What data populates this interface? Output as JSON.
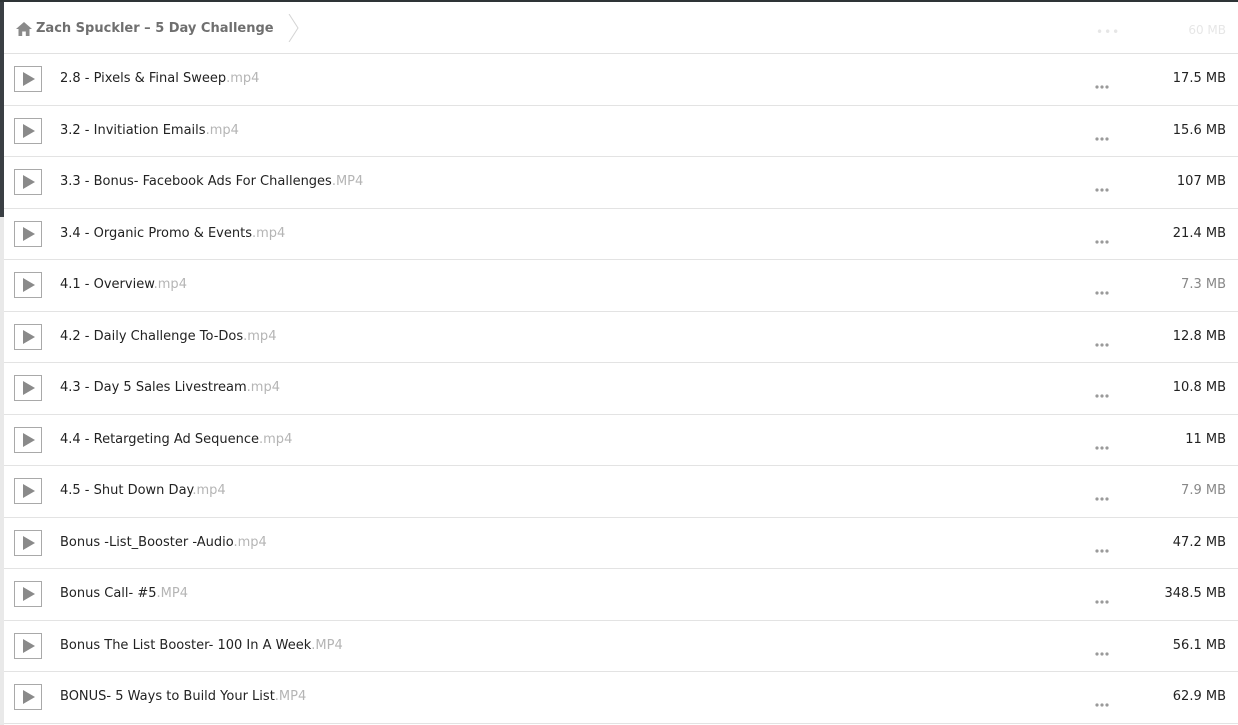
{
  "breadcrumb": {
    "folder": "Zach Spuckler – 5 Day Challenge"
  },
  "ghost_row": {
    "size": "60 MB"
  },
  "files": [
    {
      "name": "2.8 - Pixels & Final Sweep",
      "ext": ".mp4",
      "size": "17.5 MB"
    },
    {
      "name": "3.2 - Invitiation Emails",
      "ext": ".mp4",
      "size": "15.6 MB"
    },
    {
      "name": "3.3 - Bonus- Facebook Ads For Challenges",
      "ext": ".MP4",
      "size": "107 MB"
    },
    {
      "name": "3.4 - Organic Promo & Events",
      "ext": ".mp4",
      "size": "21.4 MB"
    },
    {
      "name": "4.1 - Overview",
      "ext": ".mp4",
      "size": "7.3 MB"
    },
    {
      "name": "4.2 - Daily Challenge To-Dos",
      "ext": ".mp4",
      "size": "12.8 MB"
    },
    {
      "name": "4.3 - Day 5 Sales Livestream",
      "ext": ".mp4",
      "size": "10.8 MB"
    },
    {
      "name": "4.4 - Retargeting Ad Sequence",
      "ext": ".mp4",
      "size": "11 MB"
    },
    {
      "name": "4.5 - Shut Down Day",
      "ext": ".mp4",
      "size": "7.9 MB"
    },
    {
      "name": "Bonus -List_Booster -Audio",
      "ext": ".mp4",
      "size": "47.2 MB"
    },
    {
      "name": "Bonus Call- #5",
      "ext": ".MP4",
      "size": "348.5 MB"
    },
    {
      "name": "Bonus The List Booster- 100 In A Week",
      "ext": ".MP4",
      "size": "56.1 MB"
    },
    {
      "name": "BONUS- 5 Ways to Build Your List",
      "ext": ".MP4",
      "size": "62.9 MB"
    }
  ],
  "icons": {
    "home": "home-icon",
    "play": "play-icon",
    "more": "more-dots-icon",
    "breadcrumb_separator": "chevron-right-icon"
  },
  "colors": {
    "text": "#222222",
    "extension": "#b5b5b5",
    "icon": "#8a8a8a",
    "border": "#e3e3e3"
  }
}
